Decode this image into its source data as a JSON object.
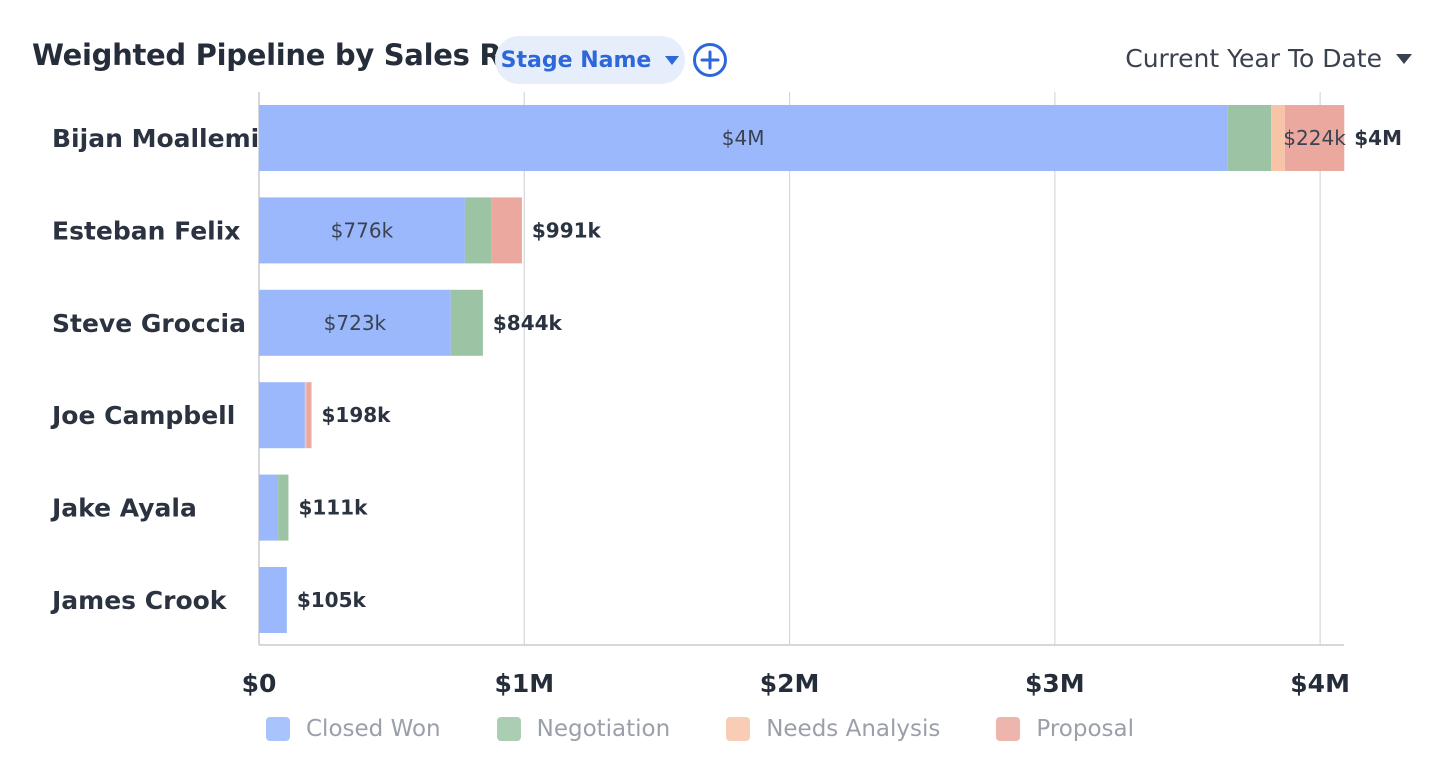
{
  "header": {
    "title": "Weighted Pipeline by Sales Rep",
    "group_by_label": "Stage Name",
    "add_icon": "plus-circle-icon",
    "period_label": "Current Year To Date"
  },
  "colors": {
    "Closed Won": "#9ab8fb",
    "Negotiation": "#9cc4a4",
    "Needs Analysis": "#f8c4a8",
    "Proposal": "#eba89f",
    "gridline": "#d5d8de",
    "accent": "#2d67da"
  },
  "chart_data": {
    "type": "bar",
    "orientation": "horizontal",
    "stacked": true,
    "title": "Weighted Pipeline by Sales Rep",
    "categories": [
      "Bijan Moallemi",
      "Esteban Felix",
      "Steve Groccia",
      "Joe Campbell",
      "Jake Ayala",
      "James Crook"
    ],
    "series": [
      {
        "name": "Closed Won",
        "values": [
          3650000,
          776000,
          723000,
          173000,
          72000,
          105000
        ],
        "labels": [
          "$4M",
          "$776k",
          "$723k",
          "",
          "",
          ""
        ]
      },
      {
        "name": "Negotiation",
        "values": [
          165000,
          99000,
          121000,
          0,
          39000,
          0
        ],
        "labels": [
          "",
          "",
          "",
          "",
          "",
          ""
        ]
      },
      {
        "name": "Needs Analysis",
        "values": [
          52000,
          0,
          0,
          5000,
          0,
          0
        ],
        "labels": [
          "",
          "",
          "",
          "",
          "",
          ""
        ]
      },
      {
        "name": "Proposal",
        "values": [
          224000,
          116000,
          0,
          20000,
          0,
          0
        ],
        "labels": [
          "$224k",
          "",
          "",
          "",
          "",
          ""
        ]
      }
    ],
    "totals": [
      "$4M",
      "$991k",
      "$844k",
      "$198k",
      "$111k",
      "$105k"
    ],
    "x_ticks": [
      {
        "value": 0,
        "label": "$0"
      },
      {
        "value": 1000000,
        "label": "$1M"
      },
      {
        "value": 2000000,
        "label": "$2M"
      },
      {
        "value": 3000000,
        "label": "$3M"
      },
      {
        "value": 4000000,
        "label": "$4M"
      }
    ],
    "xlim": [
      0,
      4090000
    ],
    "grid": true,
    "legend_position": "bottom"
  }
}
